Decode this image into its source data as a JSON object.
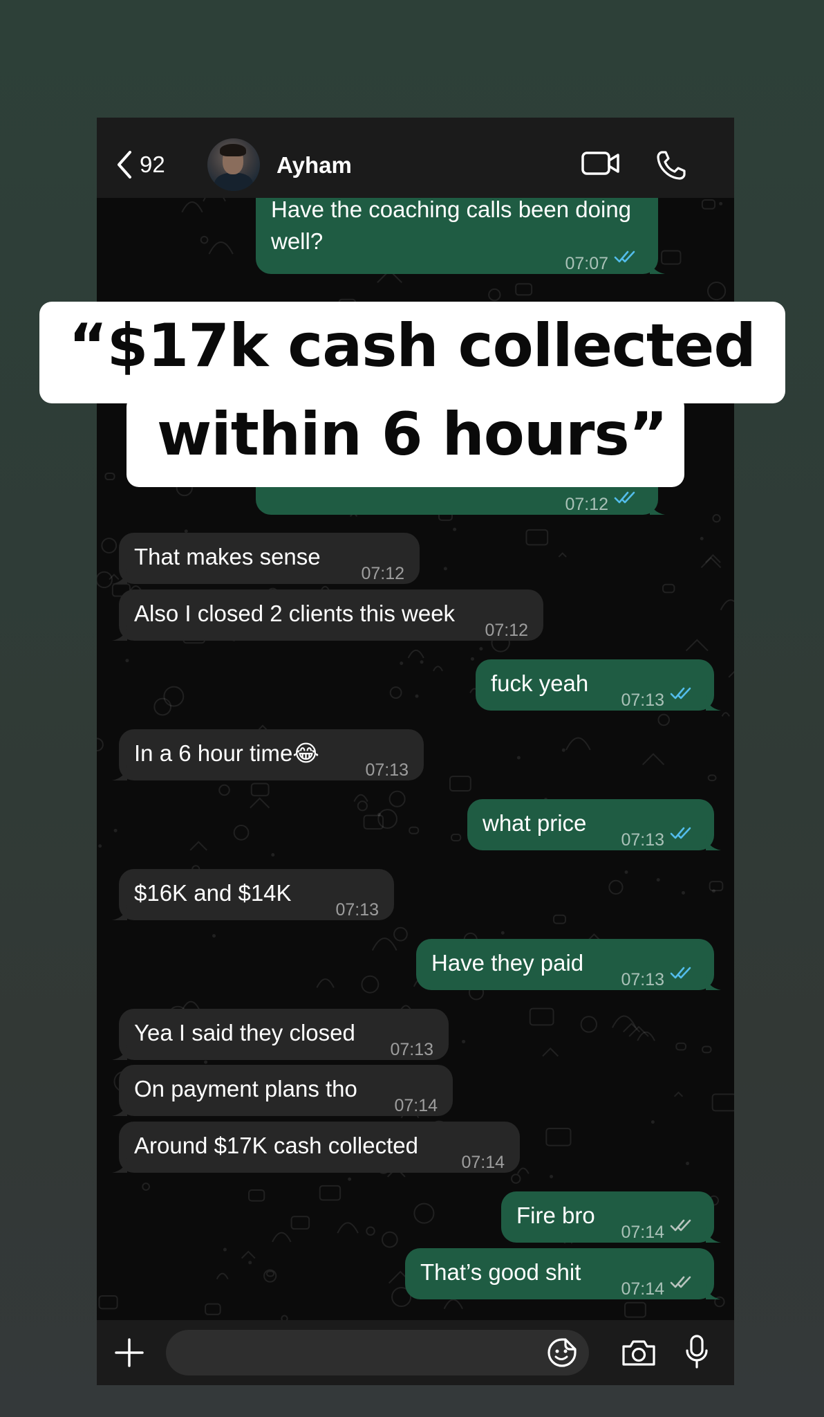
{
  "header": {
    "back_count": "92",
    "contact_name": "Ayham"
  },
  "messages": [
    {
      "dir": "out",
      "text": "Have the coaching calls been doing",
      "text2": "well?",
      "time": "07:07",
      "read": true
    },
    {
      "dir": "out",
      "text": "",
      "time": "07:12",
      "read": true
    },
    {
      "dir": "in",
      "text": "That makes sense",
      "time": "07:12"
    },
    {
      "dir": "in",
      "text": "Also I closed 2 clients this week",
      "time": "07:12"
    },
    {
      "dir": "out",
      "text": "fuck yeah",
      "time": "07:13",
      "read": true
    },
    {
      "dir": "in",
      "text": "In a 6 hour time😂",
      "time": "07:13"
    },
    {
      "dir": "out",
      "text": "what price",
      "time": "07:13",
      "read": true
    },
    {
      "dir": "in",
      "text": "$16K and $14K",
      "time": "07:13"
    },
    {
      "dir": "out",
      "text": "Have they paid",
      "time": "07:13",
      "read": true
    },
    {
      "dir": "in",
      "text": "Yea I said they closed",
      "time": "07:13"
    },
    {
      "dir": "in",
      "text": "On payment plans tho",
      "time": "07:14"
    },
    {
      "dir": "in",
      "text": "Around $17K cash collected",
      "time": "07:14"
    },
    {
      "dir": "out",
      "text": "Fire bro",
      "time": "07:14",
      "read": false
    },
    {
      "dir": "out",
      "text": "That’s good shit",
      "time": "07:14",
      "read": false
    }
  ],
  "composer": {
    "placeholder": ""
  },
  "overlay": {
    "line1": "“$17k cash collected",
    "line2": "within 6 hours”"
  },
  "colors": {
    "outgoing_bubble": "#1f5c43",
    "incoming_bubble": "#272727",
    "read_tick": "#53bdeb",
    "sent_tick": "#b9c4bf"
  },
  "icons": [
    "chevron-left-icon",
    "video-call-icon",
    "phone-icon",
    "plus-icon",
    "sticker-icon",
    "camera-icon",
    "microphone-icon",
    "double-check-icon"
  ]
}
